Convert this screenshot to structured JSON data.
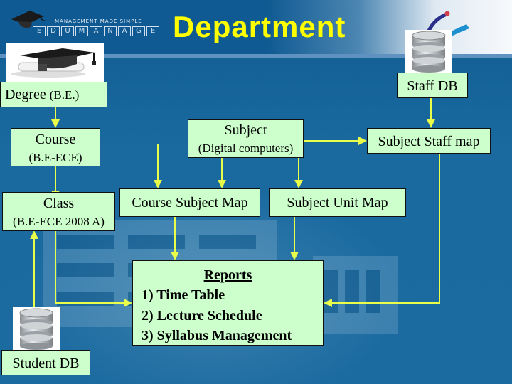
{
  "header": {
    "title": "Department",
    "logo": {
      "tagline": "MANAGEMENT MADE SIMPLE",
      "letters": [
        "E",
        "D",
        "U",
        "M",
        "A",
        "N",
        "A",
        "G",
        "E"
      ],
      "icon": "graduation-cap-icon"
    },
    "corner_icon": "swoosh-logo-icon"
  },
  "colors": {
    "background": "#15649a",
    "title": "#ffff00",
    "box_fill": "#ccffcc",
    "connector": "#eaff4a"
  },
  "nodes": {
    "degree": {
      "label": "Degree",
      "detail": "(B.E.)",
      "icon": "graduation-cap-icon"
    },
    "course": {
      "label": "Course",
      "detail": "(B.E-ECE)"
    },
    "class": {
      "label": "Class",
      "detail": "(B.E-ECE 2008 A)"
    },
    "subject": {
      "label": "Subject",
      "detail": "(Digital computers)"
    },
    "course_subject_map": {
      "label": "Course Subject Map"
    },
    "subject_unit_map": {
      "label": "Subject Unit Map"
    },
    "subject_staff_map": {
      "label": "Subject Staff map"
    },
    "staff_db": {
      "label": "Staff DB",
      "icon": "database-icon"
    },
    "student_db": {
      "label": "Student DB",
      "icon": "database-icon"
    },
    "reports": {
      "title": "Reports",
      "items": [
        "1) Time Table",
        "2) Lecture Schedule",
        "3) Syllabus Management"
      ]
    }
  },
  "edges": [
    {
      "from": "degree",
      "to": "course"
    },
    {
      "from": "course",
      "to": "class"
    },
    {
      "from": "course",
      "to": "course_subject_map"
    },
    {
      "from": "subject",
      "to": "course_subject_map"
    },
    {
      "from": "subject",
      "to": "subject_unit_map"
    },
    {
      "from": "subject",
      "to": "subject_staff_map"
    },
    {
      "from": "staff_db",
      "to": "subject_staff_map"
    },
    {
      "from": "student_db",
      "to": "class"
    },
    {
      "from": "class",
      "to": "reports"
    },
    {
      "from": "course_subject_map",
      "to": "reports"
    },
    {
      "from": "subject_unit_map",
      "to": "reports"
    },
    {
      "from": "subject_staff_map",
      "to": "reports"
    }
  ]
}
